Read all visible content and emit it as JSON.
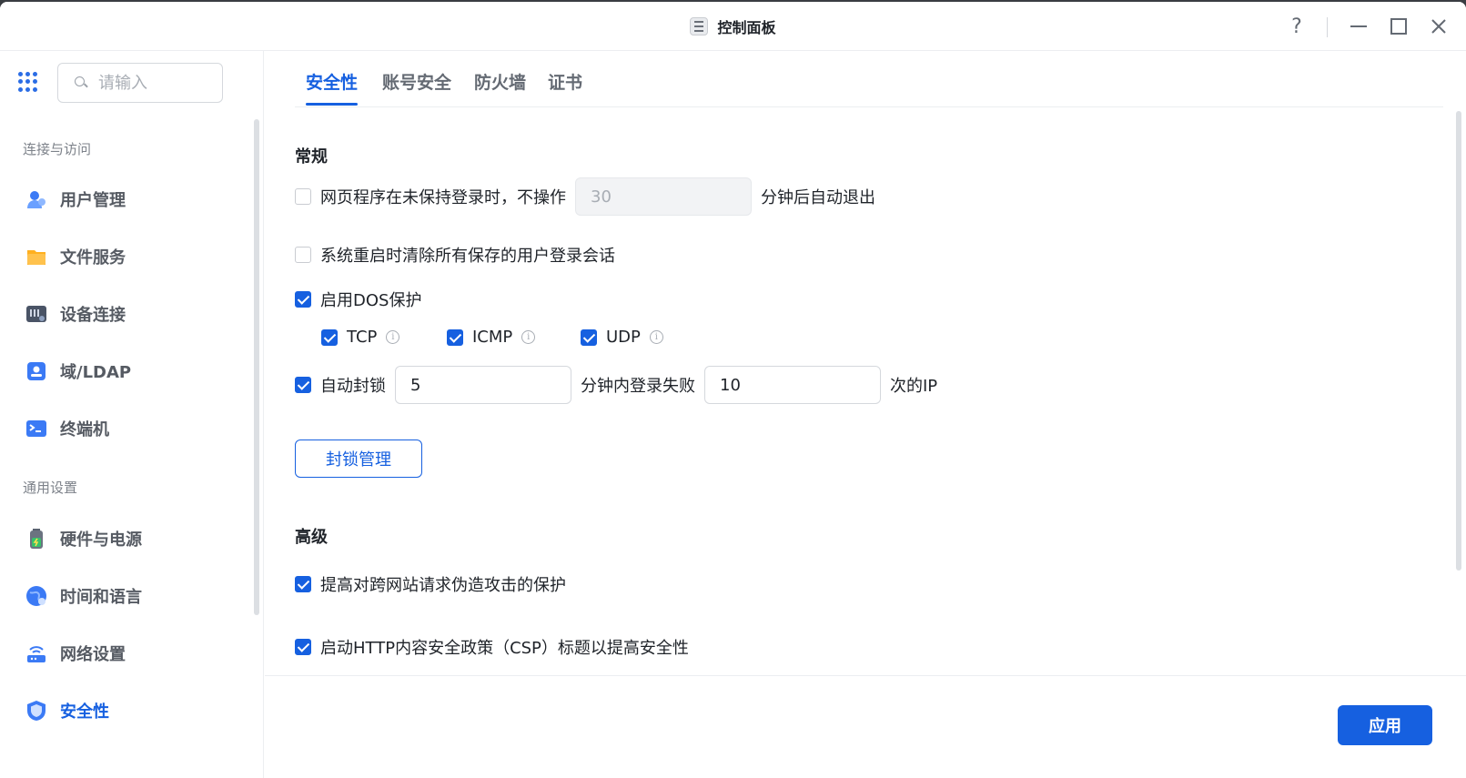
{
  "window": {
    "title": "控制面板",
    "help_label": "?"
  },
  "search": {
    "placeholder": "请输入"
  },
  "sidebar": {
    "groups": [
      {
        "label": "连接与访问"
      },
      {
        "label": "通用设置"
      }
    ],
    "items": [
      {
        "label": "用户管理",
        "icon": "users-icon"
      },
      {
        "label": "文件服务",
        "icon": "folder-icon"
      },
      {
        "label": "设备连接",
        "icon": "device-icon"
      },
      {
        "label": "域/LDAP",
        "icon": "ldap-icon"
      },
      {
        "label": "终端机",
        "icon": "terminal-icon"
      },
      {
        "label": "硬件与电源",
        "icon": "battery-icon"
      },
      {
        "label": "时间和语言",
        "icon": "globe-icon"
      },
      {
        "label": "网络设置",
        "icon": "router-icon"
      },
      {
        "label": "安全性",
        "icon": "shield-icon",
        "active": true
      }
    ]
  },
  "tabs": [
    {
      "label": "安全性",
      "active": true
    },
    {
      "label": "账号安全"
    },
    {
      "label": "防火墙"
    },
    {
      "label": "证书"
    }
  ],
  "general": {
    "title": "常规",
    "timeout": {
      "checked": false,
      "prefix": "网页程序在未保持登录时，不操作",
      "value": "30",
      "suffix": "分钟后自动退出"
    },
    "clear_sessions": {
      "checked": false,
      "label": "系统重启时清除所有保存的用户登录会话"
    },
    "dos": {
      "checked": true,
      "label": "启用DOS保护",
      "protocols": [
        {
          "label": "TCP",
          "checked": true
        },
        {
          "label": "ICMP",
          "checked": true
        },
        {
          "label": "UDP",
          "checked": true
        }
      ]
    },
    "auto_block": {
      "checked": true,
      "prefix": "自动封锁",
      "minutes": "5",
      "middle": "分钟内登录失败",
      "attempts": "10",
      "suffix": "次的IP"
    },
    "block_manage_label": "封锁管理"
  },
  "advanced": {
    "title": "高级",
    "csrf": {
      "checked": true,
      "label": "提高对跨网站请求伪造攻击的保护"
    },
    "csp": {
      "checked": true,
      "label": "启动HTTP内容安全政策（CSP）标题以提高安全性"
    }
  },
  "footer": {
    "apply_label": "应用"
  },
  "colors": {
    "accent": "#1660e0"
  }
}
